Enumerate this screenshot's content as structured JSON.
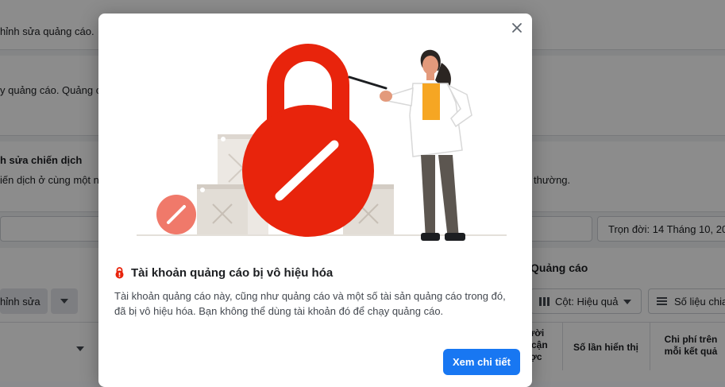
{
  "background": {
    "row1_text": "hỉnh sửa quảng cáo.",
    "row2_text": "y quảng cáo. Quảng cá",
    "row3_title": "h sửa chiến dịch",
    "row3_text": "iến dịch ở cùng một n",
    "row3_text_right": "thường.",
    "date_range": "Trọn đời: 14 Tháng 10, 202",
    "section_title": "Quảng cáo",
    "edit_button": "hỉnh sửa",
    "columns_button": "Cột: Hiệu quả",
    "breakdown_button": "Số liệu chia",
    "col_reach": "Người\ntiếp cận\nđược",
    "col_impressions": "Số lần hiển thị",
    "col_cost": "Chi phí trên\nmỗi kết quả"
  },
  "modal": {
    "title": "Tài khoản quảng cáo bị vô hiệu hóa",
    "body": "Tài khoản quảng cáo này, cũng như quảng cáo và một số tài sản quảng cáo trong đó, đã bị vô hiệu hóa. Bạn không thể dùng tài khoản đó để chạy quảng cáo.",
    "primary_button": "Xem chi tiết",
    "title_icon": "lock-alert-icon",
    "close_icon": "close-icon"
  },
  "colors": {
    "accent": "#1877f2",
    "lock_red": "#e8240c",
    "coral": "#f0796a"
  }
}
